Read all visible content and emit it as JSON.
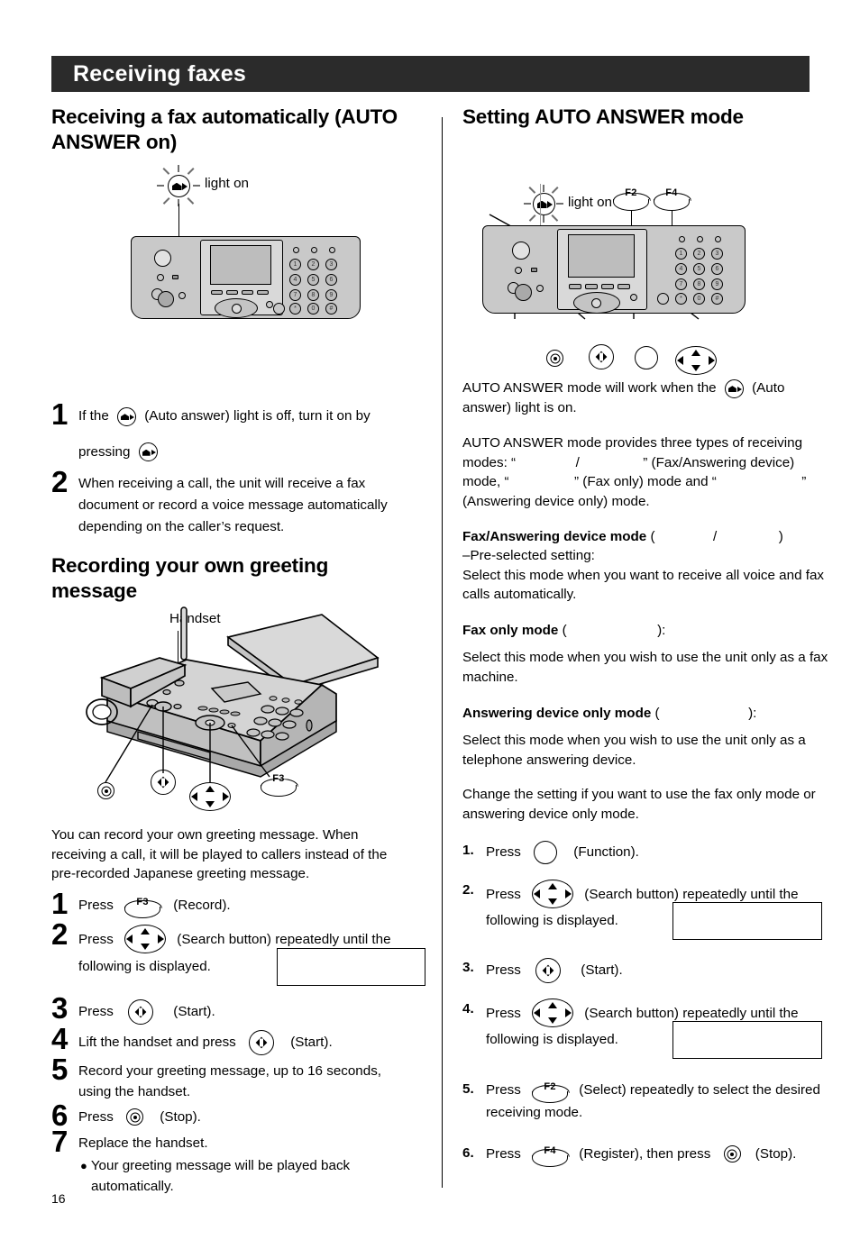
{
  "banner": {
    "title": "Receiving faxes"
  },
  "page": {
    "number": "16"
  },
  "left": {
    "heading": "Receiving a fax automatically (AUTO ANSWER on)",
    "fig1": {
      "light_label": "light on",
      "auto_answer_icon": "auto-answer-icon",
      "keypad_digits": [
        "1",
        "2",
        "3",
        "4",
        "5",
        "6",
        "7",
        "8",
        "9",
        "*",
        "0",
        "#"
      ]
    },
    "steps": [
      {
        "num": "1",
        "t1": "If the",
        "t2": "(Auto answer) light is off, turn it on by",
        "t3": "pressing"
      },
      {
        "num": "2",
        "t1": "When receiving a call, the unit will receive a fax document or record a voice message automatically depending on the caller’s request."
      }
    ],
    "heading2": "Recording your own greeting message",
    "fig2": {
      "handset_label": "Handset",
      "fkey_label": "F3",
      "stop_icon": "stop-button-icon",
      "start_icon": "start-button-icon",
      "search_icon": "search-button-icon"
    },
    "intro": "You can record your own greeting message. When receiving a call, it will be played to callers instead of the pre-recorded Japanese greeting message.",
    "rec_steps": [
      {
        "num": "1",
        "pre": "Press",
        "key": "F3",
        "post": "(Record)."
      },
      {
        "num": "2",
        "pre": "Press",
        "post": "(Search button) repeatedly until the",
        "post2": "following is displayed."
      },
      {
        "num": "3",
        "pre": "Press",
        "post": "(Start)."
      },
      {
        "num": "4",
        "pre": "Lift the handset and press",
        "post": "(Start)."
      },
      {
        "num": "5",
        "pre": "Record your greeting message, up to 16 seconds, using the handset."
      },
      {
        "num": "6",
        "pre": "Press",
        "post": "(Stop)."
      },
      {
        "num": "7",
        "pre": "Replace the handset.",
        "bullet": "Your greeting message will be played back automatically."
      }
    ]
  },
  "right": {
    "heading": "Setting AUTO ANSWER mode",
    "fig": {
      "light_label": "light on",
      "fkey_f2": "F2",
      "fkey_f4": "F4",
      "keypad_digits": [
        "1",
        "2",
        "3",
        "4",
        "5",
        "6",
        "7",
        "8",
        "9",
        "*",
        "0",
        "#"
      ]
    },
    "p1_a": "AUTO ANSWER mode will work when the",
    "p1_b": "(Auto answer) light is on.",
    "p2_a": "AUTO ANSWER mode provides three types of receiving modes: “",
    "p2_sep": "/",
    "p2_b": "” (Fax/Answering device) mode,",
    "p2_c": "“",
    "p2_d": "” (Fax only) mode and “",
    "p2_e": "”",
    "p2_f": "(Answering device only) mode.",
    "mode1_title": "Fax/Answering device mode",
    "mode1_paren_open": "(",
    "mode1_paren_sep": "/",
    "mode1_paren_close": ")",
    "mode1_line1": "–Pre-selected setting:",
    "mode1_line2": "Select this mode when you want to receive all voice and fax calls automatically.",
    "mode2_title": "Fax only mode",
    "mode2_paren_open": "(",
    "mode2_paren_close": "):",
    "mode2_body": "Select this mode when you wish to use the unit only as a fax machine.",
    "mode3_title": "Answering device only mode",
    "mode3_paren_open": "(",
    "mode3_paren_close": "):",
    "mode3_body": "Select this mode when you wish to use the unit only as a telephone answering device.",
    "change_note": "Change the setting if you want to use the fax only mode or answering device only mode.",
    "steps": [
      {
        "num": "1.",
        "pre": "Press",
        "post": "(Function)."
      },
      {
        "num": "2.",
        "pre": "Press",
        "post": "(Search button) repeatedly until the",
        "post2": "following is displayed."
      },
      {
        "num": "3.",
        "pre": "Press",
        "post": "(Start)."
      },
      {
        "num": "4.",
        "pre": "Press",
        "post": "(Search button) repeatedly until the",
        "post2": "following is displayed."
      },
      {
        "num": "5.",
        "pre": "Press",
        "key": "F2",
        "post": "(Select) repeatedly to select the desired",
        "post2": "receiving mode."
      },
      {
        "num": "6.",
        "pre": "Press",
        "key": "F4",
        "post": "(Register), then press",
        "post3": "(Stop)."
      }
    ]
  },
  "colors": {
    "banner_bg": "#2b2b2b",
    "banner_text": "#ffffff",
    "panel_body": "#c9c9c9",
    "lcd": "#bdbdbd",
    "ink": "#000000",
    "page_bg": "#ffffff"
  }
}
